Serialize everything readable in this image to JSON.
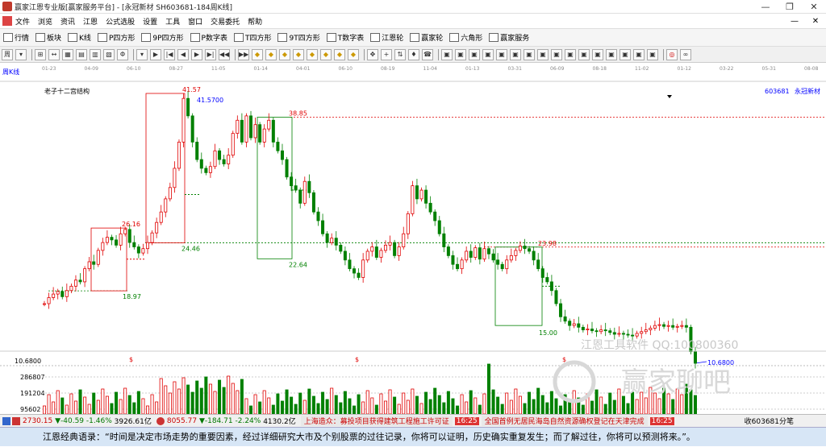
{
  "window": {
    "title": "赢家江恩专业版[赢家服务平台] - [永冠新材  SH603681-184周K线]",
    "min": "—",
    "max": "❐",
    "close": "✕"
  },
  "menu": {
    "items": [
      "文件",
      "浏览",
      "资讯",
      "江恩",
      "公式选股",
      "设置",
      "工具",
      "窗口",
      "交易委托",
      "帮助"
    ],
    "right": [
      "—",
      "✕"
    ]
  },
  "toolbar1": {
    "items": [
      {
        "icon": "grid-icon",
        "label": "行情"
      },
      {
        "icon": "block-icon",
        "label": "板块"
      },
      {
        "icon": "candle-icon",
        "label": "K线"
      },
      {
        "icon": "p-square-icon",
        "label": "P四方形"
      },
      {
        "icon": "9p-square-icon",
        "label": "9P四方形"
      },
      {
        "icon": "pn-table-icon",
        "label": "P数字表"
      },
      {
        "icon": "t-square-icon",
        "label": "T四方形"
      },
      {
        "icon": "9t-square-icon",
        "label": "9T四方形"
      },
      {
        "icon": "tn-table-icon",
        "label": "T数字表"
      },
      {
        "icon": "wheel-icon",
        "label": "江恩轮"
      },
      {
        "icon": "win-wheel-icon",
        "label": "赢家轮"
      },
      {
        "icon": "hexagon-icon",
        "label": "六角形"
      },
      {
        "icon": "service-icon",
        "label": "赢家服务"
      }
    ]
  },
  "toolbar2": {
    "icons": [
      "周",
      "▾",
      "⊞",
      "↔",
      "▦",
      "▤",
      "▥",
      "▧",
      "Φ",
      "▾",
      "▶",
      "|◀",
      "◀",
      "▶",
      "▶|",
      "◀◀",
      "▶▶",
      "◆",
      "◆",
      "◆",
      "◆",
      "◆",
      "◆",
      "◆",
      "◆",
      "✥",
      "+",
      "⇅",
      "♦",
      "☎",
      "▣",
      "▣",
      "▣",
      "▣",
      "▣",
      "▣",
      "▣",
      "▣",
      "▣",
      "▣",
      "▣",
      "▣",
      "▣",
      "▣",
      "▣",
      "▣",
      "◎",
      "∞"
    ]
  },
  "chart": {
    "period_label": "周K线",
    "indicator_title": "老子十二宫结构",
    "stock_code": "603681",
    "stock_name": "永冠新材",
    "dates": [
      "01-23",
      "04-09",
      "06-10",
      "08-27",
      "11-05",
      "01-14",
      "04-01",
      "06-10",
      "08-19",
      "11-04",
      "01-13",
      "03-31",
      "06-09",
      "08-18",
      "11-02",
      "01-12",
      "03-22",
      "05-31",
      "08-08"
    ],
    "price_labels": {
      "p4157": "41.57",
      "p415700": "41.5700",
      "p3885": "38.85",
      "p2616": "26.16",
      "p2446": "24.46",
      "p2398": "23.98",
      "p2264": "22.64",
      "p1897": "18.97",
      "p1500": "15.00",
      "p106800": "10.6800"
    },
    "axis_label": "10.6800",
    "dollar_marks": [
      "$",
      "$",
      "$"
    ],
    "volume_axis": [
      "286807",
      "191204",
      "95602"
    ],
    "watermark1": "江恩工具软件  QQ:100800360",
    "watermark2": "赢家聊吧",
    "colors": {
      "up": "#e00000",
      "down": "#008000",
      "box": "#e00000",
      "green_box": "#008000"
    }
  },
  "status": {
    "sh_index": "2730.15",
    "sh_change": "▼-40.59",
    "sh_pct": "-1.46%",
    "sh_amount": "3926.61亿",
    "sz_index": "8055.77",
    "sz_change": "▼-184.71",
    "sz_pct": "-2.24%",
    "sz_amount": "4130.2亿",
    "news1": "上海造众：募投项目获得建筑工程施工许可证",
    "time1": "16:25",
    "news2": "全国首例无居民海岛自然资源确权登记在天津完成",
    "time2": "16:25",
    "right_text": "收603681分笔"
  },
  "quote": "江恩经典语录：“时间是决定市场走势的重要因素，经过详细研究大市及个别股票的过往记录，你将可以证明，历史确实重复发生；而了解过往，你将可以预测将来。”。"
}
